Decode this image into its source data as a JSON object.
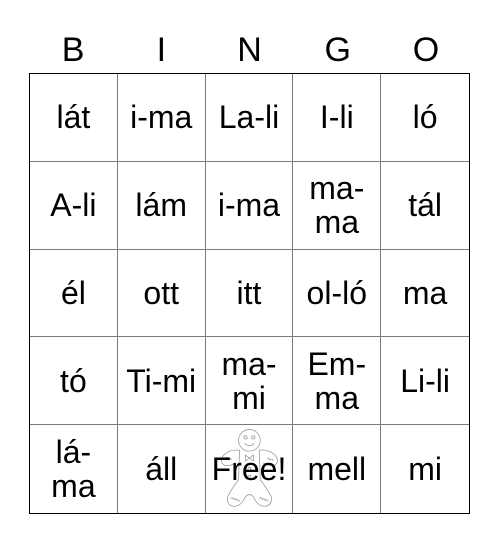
{
  "header": {
    "letters": [
      "B",
      "I",
      "N",
      "G",
      "O"
    ]
  },
  "card": {
    "rows": [
      [
        "lát",
        "i-ma",
        "La-li",
        "I-li",
        "ló"
      ],
      [
        "A-li",
        "lám",
        "i-ma",
        "ma-\nma",
        "tál"
      ],
      [
        "él",
        "ott",
        "itt",
        "ol-ló",
        "ma"
      ],
      [
        "tó",
        "Ti-mi",
        "ma-\nmi",
        "Em-\nma",
        "Li-li"
      ],
      [
        "lá-\nma",
        "áll",
        "Free!",
        "mell",
        "mi"
      ]
    ],
    "free_space": {
      "row": 4,
      "col": 2,
      "icon": "gingerbread-man-icon"
    }
  }
}
